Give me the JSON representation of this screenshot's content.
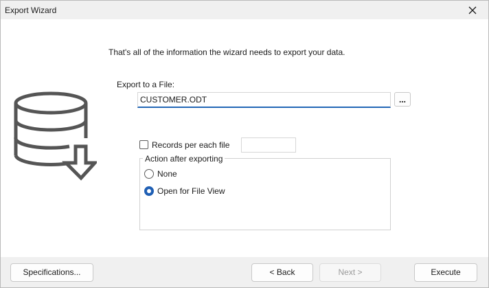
{
  "window": {
    "title": "Export Wizard"
  },
  "intro_text": "That's all of the information the wizard needs to export your data.",
  "export_file": {
    "label": "Export to a File:",
    "value": "CUSTOMER.ODT",
    "browse_label": "..."
  },
  "records": {
    "label": "Records per each file",
    "checked": false,
    "value": ""
  },
  "action_group": {
    "legend": "Action after exporting",
    "options": [
      {
        "label": "None",
        "checked": false
      },
      {
        "label": "Open for File View",
        "checked": true
      }
    ]
  },
  "buttons": {
    "specifications": "Specifications...",
    "back": "< Back",
    "next": "Next >",
    "execute": "Execute"
  },
  "colors": {
    "accent": "#1f5fb4",
    "icon": "#555555"
  },
  "icons": [
    "close-icon",
    "database-export-icon"
  ]
}
